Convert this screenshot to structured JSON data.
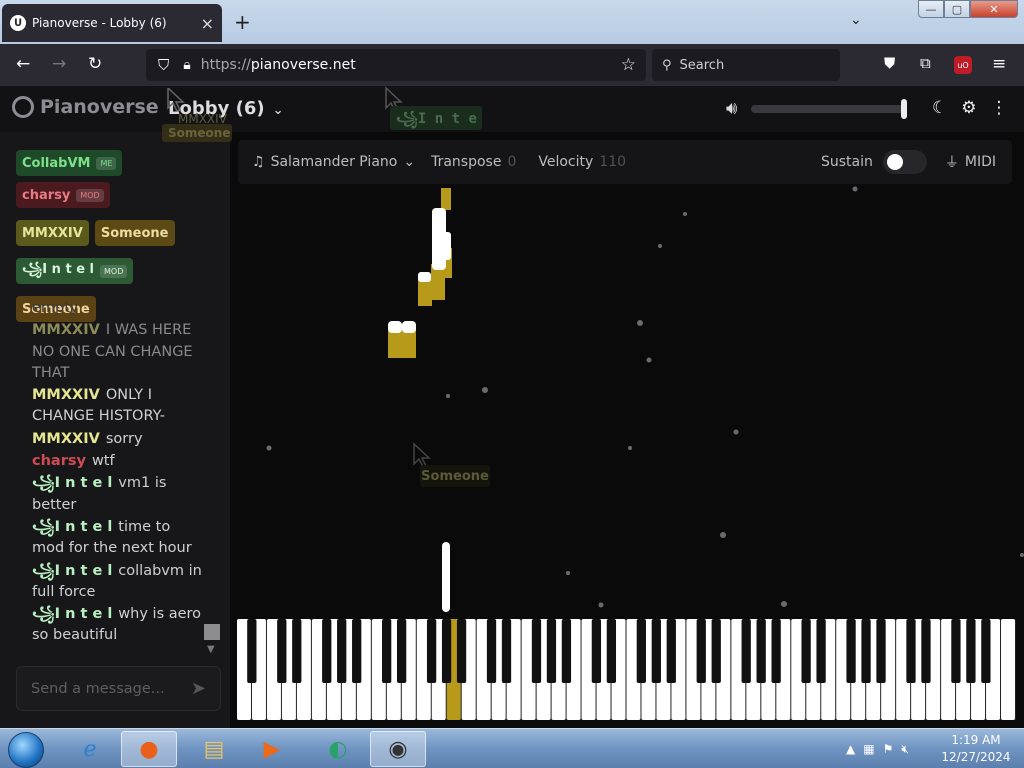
{
  "browser": {
    "tab_title": "Pianoverse - Lobby (6)",
    "tab_icon": "pianoverse-logo-icon",
    "url_scheme": "https://",
    "url_host": "pianoverse.net",
    "search_placeholder": "Search",
    "window_controls": {
      "min": "—",
      "max": "▢",
      "close": "✕"
    }
  },
  "app": {
    "logo_text": "Pianoverse",
    "room_name": "Lobby (6)",
    "volume_level": 1.0
  },
  "users": [
    {
      "name": "CollabVM",
      "tag": "ME",
      "bg": "#1f4a2a",
      "fg": "#7ee08a"
    },
    {
      "name": "charsy",
      "tag": "MOD",
      "bg": "#4a1a1f",
      "fg": "#e87a84"
    },
    {
      "name": "MMXXIV",
      "tag": "",
      "bg": "#5a5a1c",
      "fg": "#e6e69a"
    },
    {
      "name": "Someone",
      "tag": "",
      "bg": "#5b4a14",
      "fg": "#f0dca0"
    },
    {
      "name": "꧁I n t e l",
      "tag": "MOD",
      "bg": "#2c5a34",
      "fg": "#d8f5dc"
    },
    {
      "name": "Someone",
      "tag": "",
      "bg": "#5b4214",
      "fg": "#f0d49a"
    }
  ],
  "chat": [
    {
      "author": "",
      "text": "empty",
      "color": "#3a3a3e"
    },
    {
      "author": "MMXXIV",
      "text": "I WAS HERE NO ONE CAN CHANGE THAT",
      "color": "#8b8b56"
    },
    {
      "author": "MMXXIV",
      "text": "ONLY I CHANGE HISTORY-",
      "color": "#e6e690"
    },
    {
      "author": "MMXXIV",
      "text": "sorry",
      "color": "#e6e690"
    },
    {
      "author": "charsy",
      "text": "wtf",
      "color": "#d04a56"
    },
    {
      "author": "꧁I n t e l",
      "text": "vm1 is better",
      "color": "#b8f0c0"
    },
    {
      "author": "꧁I n t e l",
      "text": "time to mod for the next hour",
      "color": "#b8f0c0"
    },
    {
      "author": "꧁I n t e l",
      "text": "collabvm in full force",
      "color": "#b8f0c0"
    },
    {
      "author": "꧁I n t e l",
      "text": "why is aero so beautiful",
      "color": "#b8f0c0"
    }
  ],
  "chat_input_placeholder": "Send a message...",
  "toolbar": {
    "instrument": "Salamander Piano",
    "transpose_label": "Transpose",
    "transpose_value": "0",
    "velocity_label": "Velocity",
    "velocity_value": "110",
    "sustain_label": "Sustain",
    "midi_label": "MIDI"
  },
  "cursors": [
    {
      "name": "MMXXIV"
    },
    {
      "name": "Someone"
    },
    {
      "name": "꧁I n t e l"
    },
    {
      "name": "Someone"
    }
  ],
  "taskbar": {
    "time": "1:19 AM",
    "date": "12/27/2024",
    "apps": [
      "ie-icon",
      "firefox-icon",
      "explorer-icon",
      "media-player-icon",
      "browser-icon",
      "app-icon"
    ]
  }
}
